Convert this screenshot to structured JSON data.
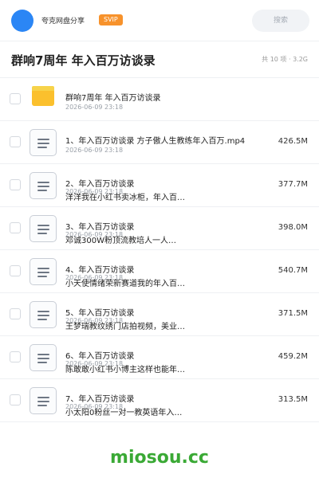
{
  "header": {
    "username": "夸克网盘分享",
    "badge": "SVIP",
    "search_placeholder": "搜索"
  },
  "folder": {
    "title": "群响7周年 年入百万访谈录",
    "summary": "共 10 项 · 3.2G"
  },
  "items": [
    {
      "type": "folder",
      "name": "群响7周年 年入百万访谈录",
      "date": "2026-06-09 23:18",
      "size": ""
    },
    {
      "type": "file",
      "name": "1、年入百万访谈录 方子傲人生教练年入百万.mp4",
      "date": "2026-06-09 23:18",
      "size": "426.5M"
    },
    {
      "type": "file",
      "name": "2、年入百万访谈录",
      "name2": "洋洋我在小红书卖冰柜，年入百…",
      "date": "2026-06-09 23:18",
      "size": "377.7M"
    },
    {
      "type": "file",
      "name": "3、年入百万访谈录",
      "name2": "邓诚300W粉顶流教培人一人…",
      "date": "2026-06-09 23:18",
      "size": "398.0M"
    },
    {
      "type": "file",
      "name": "4、年入百万访谈录",
      "name2": "小天使情绪荣新赛道我的年入百…",
      "date": "2026-06-09 23:18",
      "size": "540.7M"
    },
    {
      "type": "file",
      "name": "5、年入百万访谈录",
      "name2": "王梦瑞教纹绣门店拍视频，美业…",
      "date": "2026-06-09 23:18",
      "size": "371.5M"
    },
    {
      "type": "file",
      "name": "6、年入百万访谈录",
      "name2": "陈敢敢小红书小博主这样也能年…",
      "date": "2026-06-09 23:18",
      "size": "459.2M"
    },
    {
      "type": "file",
      "name": "7、年入百万访谈录",
      "name2": "小太阳0粉丝一对一教英语年入…",
      "date": "2026-06-09 23:18",
      "size": "313.5M"
    }
  ],
  "footer": {
    "watermark": "miosou.cc"
  }
}
